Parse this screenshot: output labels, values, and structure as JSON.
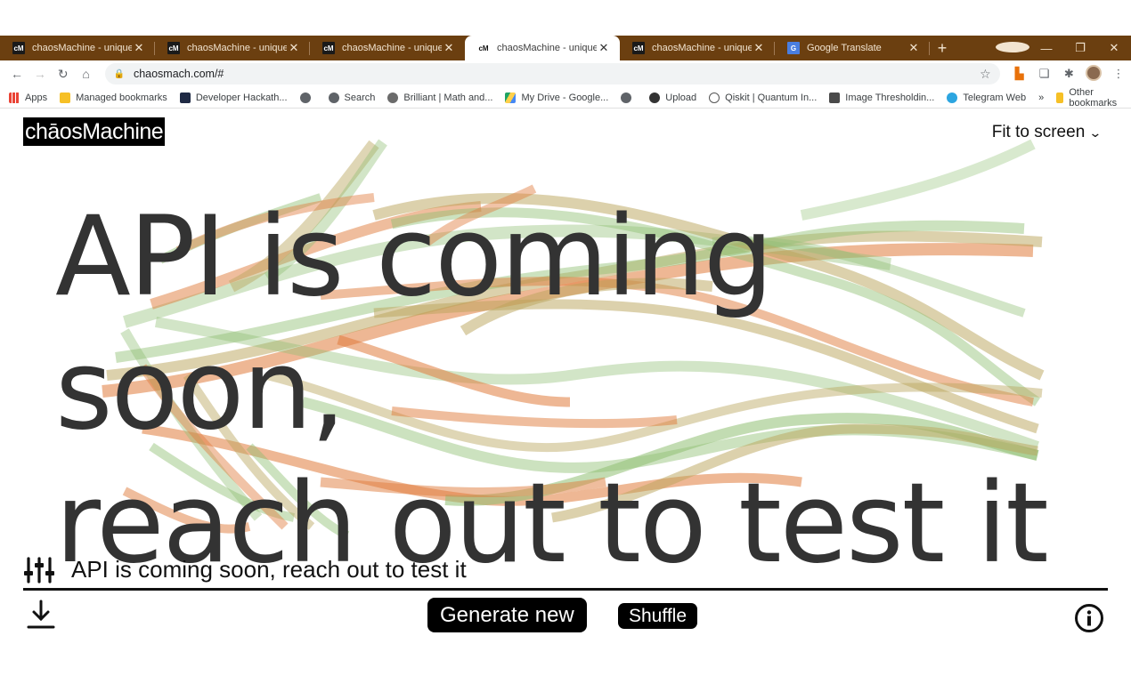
{
  "browser": {
    "tabs": [
      {
        "title": "chaosMachine - unique gen",
        "favicon": "cM",
        "active": false
      },
      {
        "title": "chaosMachine - unique gen",
        "favicon": "cM",
        "active": false
      },
      {
        "title": "chaosMachine - unique gen",
        "favicon": "cM",
        "active": false
      },
      {
        "title": "chaosMachine - unique gen",
        "favicon": "cM",
        "active": true
      },
      {
        "title": "chaosMachine - unique gen",
        "favicon": "cM",
        "active": false
      },
      {
        "title": "Google Translate",
        "favicon": "G",
        "active": false
      }
    ],
    "url": "chaosmach.com/#",
    "bookmarks": [
      {
        "label": "Apps",
        "icon": "apps-grid-icon",
        "color": "#ea4335"
      },
      {
        "label": "Managed bookmarks",
        "icon": "folder-icon",
        "color": "#f6c026"
      },
      {
        "label": "Developer Hackath...",
        "icon": "h-icon",
        "color": "#1f2a44"
      },
      {
        "label": "",
        "icon": "globe-icon",
        "color": "#5f6368"
      },
      {
        "label": "Search",
        "icon": "globe-icon",
        "color": "#5f6368"
      },
      {
        "label": "Brilliant | Math and...",
        "icon": "brilliant-icon",
        "color": "#6b6b6b"
      },
      {
        "label": "My Drive - Google...",
        "icon": "drive-icon",
        "color": "#1fa463"
      },
      {
        "label": "",
        "icon": "globe-icon",
        "color": "#5f6368"
      },
      {
        "label": "Upload",
        "icon": "upload-icon",
        "color": "#333333"
      },
      {
        "label": "Qiskit | Quantum In...",
        "icon": "qiskit-icon",
        "color": "#555555"
      },
      {
        "label": "Image Thresholdin...",
        "icon": "image-icon",
        "color": "#4a4a4a"
      },
      {
        "label": "Telegram Web",
        "icon": "telegram-icon",
        "color": "#2ca5e0"
      }
    ],
    "more_bookmarks": "»",
    "other_bookmarks": "Other bookmarks"
  },
  "app": {
    "logo": "chāosMachine",
    "fit_to_screen": "Fit to screen",
    "headline_line1": "API is coming soon,",
    "headline_line2": "reach out to test it",
    "input_value": "API is coming soon, reach out to test it",
    "generate_label": "Generate new",
    "shuffle_label": "Shuffle"
  },
  "colors": {
    "chrome_frame": "#6b3f10",
    "stroke_orange": "#e07b3c",
    "stroke_green": "#8fbf72",
    "stroke_olive": "#b9a35a",
    "text_dark": "#333333"
  }
}
